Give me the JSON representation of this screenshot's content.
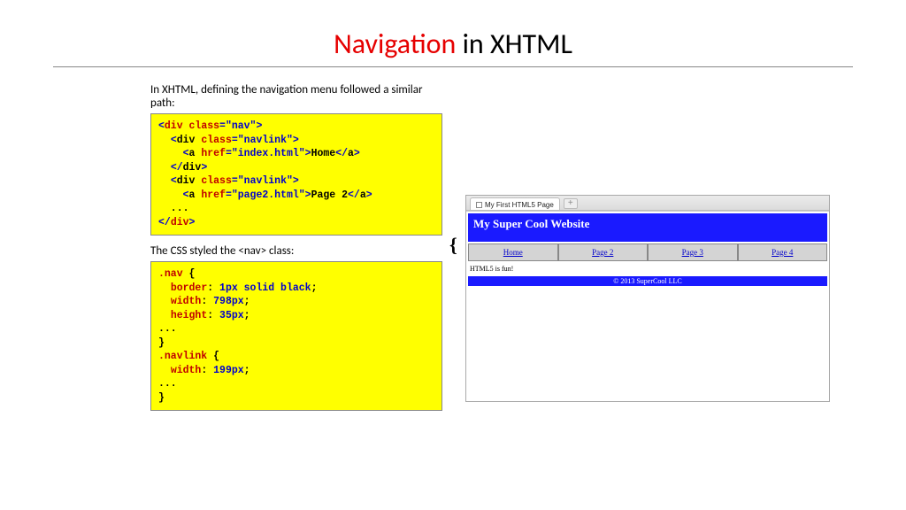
{
  "title_red": "Navigation",
  "title_rest": " in XHTML",
  "intro1": "In XHTML, defining the navigation menu followed a similar path:",
  "intro2": "The CSS styled the <nav> class:",
  "html_code": {
    "l1_open": {
      "lt": "<",
      "tag": "div",
      "sp": " ",
      "attr": "class",
      "eq": "=",
      "str": "\"nav\"",
      "gt": ">"
    },
    "l2_open": {
      "indent": "  ",
      "lt": "<",
      "tag": "div",
      "sp": " ",
      "attr": "class",
      "eq": "=",
      "str": "\"navlink\"",
      "gt": ">"
    },
    "l3_a": {
      "indent": "    ",
      "lt": "<",
      "tag": "a",
      "sp": " ",
      "attr": "href",
      "eq": "=",
      "str": "\"index.html\"",
      "gt": ">",
      "text": "Home",
      "lt2": "</",
      "tag2": "a",
      "gt2": ">"
    },
    "l4_close": {
      "indent": "  ",
      "lt": "</",
      "tag": "div",
      "gt": ">"
    },
    "l5_open": {
      "indent": "  ",
      "lt": "<",
      "tag": "div",
      "sp": " ",
      "attr": "class",
      "eq": "=",
      "str": "\"navlink\"",
      "gt": ">"
    },
    "l6_a": {
      "indent": "    ",
      "lt": "<",
      "tag": "a",
      "sp": " ",
      "attr": "href",
      "eq": "=",
      "str": "\"page2.html\"",
      "gt": ">",
      "text": "Page 2",
      "lt2": "</",
      "tag2": "a",
      "gt2": ">"
    },
    "l7_dots": "  ...",
    "l8_close": {
      "lt": "</",
      "tag": "div",
      "gt": ">"
    }
  },
  "css_code": {
    "sel1": ".nav",
    "brace_open": " {",
    "p1": {
      "indent": "  ",
      "prop": "border",
      "colon": ": ",
      "val": "1px solid black",
      "semi": ";"
    },
    "p2": {
      "indent": "  ",
      "prop": "width",
      "colon": ": ",
      "val": "798px",
      "semi": ";"
    },
    "p3": {
      "indent": "  ",
      "prop": "height",
      "colon": ": ",
      "val": "35px",
      "semi": ";"
    },
    "dots1": "...",
    "brace_close": "}",
    "sel2": ".navlink",
    "p4": {
      "indent": "  ",
      "prop": "width",
      "colon": ": ",
      "val": "199px",
      "semi": ";"
    },
    "dots2": "...",
    "brace_close2": "}"
  },
  "brace": "{",
  "browser": {
    "tab_title": "My First HTML5 Page",
    "newtab": "+",
    "header": "My Super Cool Website",
    "nav": [
      "Home",
      "Page 2",
      "Page 3",
      "Page 4"
    ],
    "body": "HTML5 is fun!",
    "footer": "© 2013 SuperCool LLC"
  }
}
